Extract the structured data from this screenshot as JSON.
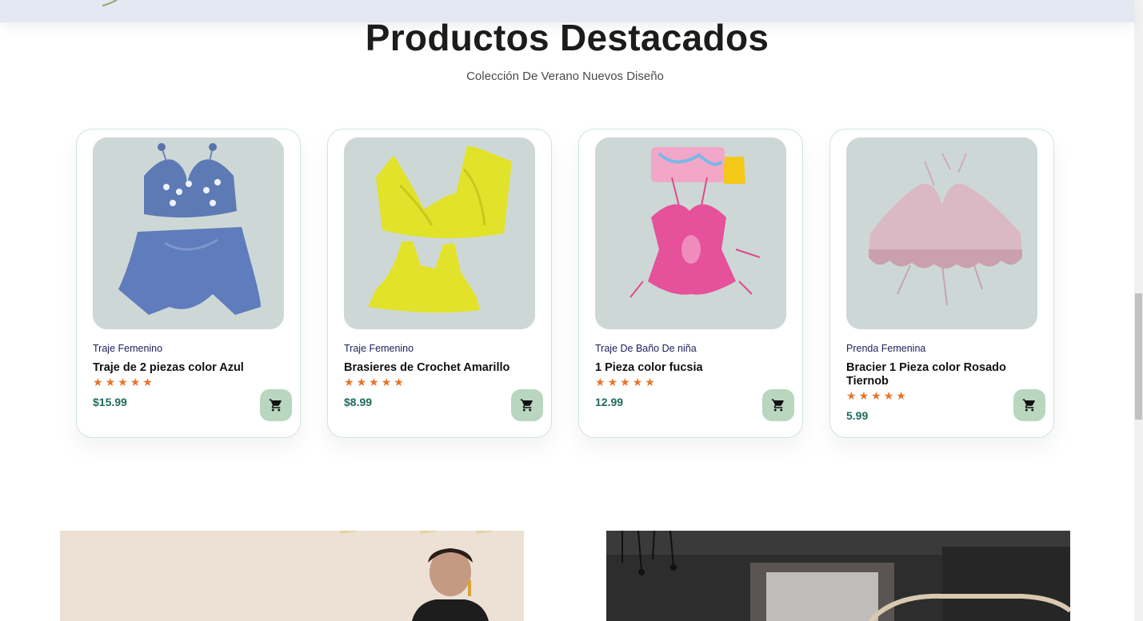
{
  "section": {
    "title": "Productos Destacados",
    "subtitle": "Colección De Verano Nuevos Diseño"
  },
  "products": [
    {
      "category": "Traje Femenino",
      "name": "Traje de 2 piezas color Azul",
      "price": "$15.99",
      "rating": 5,
      "image_icon": "blue-crochet-set-image"
    },
    {
      "category": "Traje Femenino",
      "name": "Brasieres de Crochet Amarillo",
      "price": "$8.99",
      "rating": 5,
      "image_icon": "yellow-crochet-bras-image"
    },
    {
      "category": "Traje De Baño De niña",
      "name": "1 Pieza color fucsia",
      "price": "12.99",
      "rating": 5,
      "image_icon": "pink-swimsuit-image"
    },
    {
      "category": "Prenda Femenina",
      "name": "Bracier 1 Pieza color Rosado Tiernob",
      "price": "5.99",
      "rating": 5,
      "image_icon": "rose-crochet-top-image"
    }
  ],
  "icons": {
    "star": "star-icon",
    "cart": "cart-icon"
  },
  "colors": {
    "topbar": "#e3e8f3",
    "card_border": "#cfe5dc",
    "image_bg": "#cdd8d6",
    "star": "#e8742a",
    "price": "#1d6b5c",
    "cart_button": "#b9d6bf",
    "category": "#1b1f5a"
  }
}
